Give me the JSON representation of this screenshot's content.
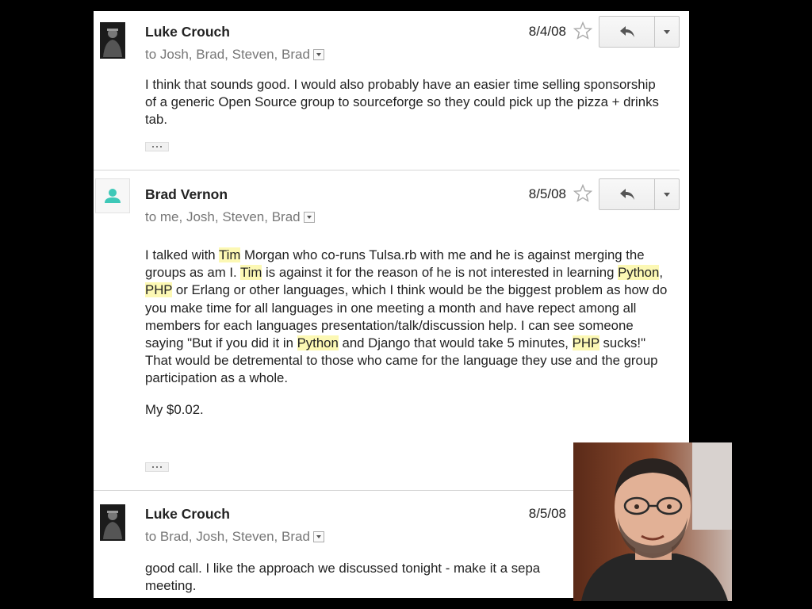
{
  "colors": {
    "background": "#000000",
    "panel": "#ffffff",
    "highlight": "#fcf8b4",
    "generic_avatar": "#3ec8b8",
    "secondary_text": "#777777"
  },
  "messages": [
    {
      "sender": "Luke Crouch",
      "recipients": "to Josh, Brad, Steven, Brad",
      "date": "8/4/08",
      "avatar_icon": "user-photo-icon",
      "paragraphs": [
        [
          {
            "t": "I think that sounds good. I would also probably have an easier time selling sponsorship of a generic Open Source group to sourceforge so they could pick up the pizza + drinks tab."
          }
        ]
      ]
    },
    {
      "sender": "Brad Vernon",
      "recipients": "to me, Josh, Steven, Brad",
      "date": "8/5/08",
      "avatar_icon": "person-icon",
      "paragraphs": [
        [
          {
            "t": "I talked with "
          },
          {
            "t": "Tim",
            "hl": true
          },
          {
            "t": " Morgan who co-runs Tulsa.rb with me and he is against merging the groups as am I.  "
          },
          {
            "t": "Tim",
            "hl": true
          },
          {
            "t": " is against it for the reason of he is not interested in learning "
          },
          {
            "t": "Python",
            "hl": true
          },
          {
            "t": ", "
          },
          {
            "t": "PHP",
            "hl": true
          },
          {
            "t": " or Erlang or other languages, which I think would be the biggest problem as how do you make time for all languages in one meeting a month and have repect among all members for each languages presentation/talk/discussion help.  I can see someone saying \"But if you did it in "
          },
          {
            "t": "Python",
            "hl": true
          },
          {
            "t": " and Django that would take 5 minutes, "
          },
          {
            "t": "PHP",
            "hl": true
          },
          {
            "t": " sucks!\" That would be detremental to those who came for the language they use and the group participation as a whole."
          }
        ],
        [
          {
            "t": "My $0.02."
          }
        ]
      ]
    },
    {
      "sender": "Luke Crouch",
      "recipients": "to Brad, Josh, Steven, Brad",
      "date": "8/5/08",
      "avatar_icon": "user-photo-icon",
      "paragraphs": [
        [
          {
            "t": "good call. I like the approach we discussed tonight - make it a sepa"
          },
          {
            "t": "meeting.",
            "br": true
          }
        ]
      ]
    }
  ],
  "icons": {
    "star": "star-icon",
    "reply": "reply-icon",
    "more": "chevron-down-icon",
    "recipients_dropdown": "chevron-down-icon",
    "expand": "ellipsis-icon"
  },
  "photo": {
    "subject": "speaker-photo"
  }
}
